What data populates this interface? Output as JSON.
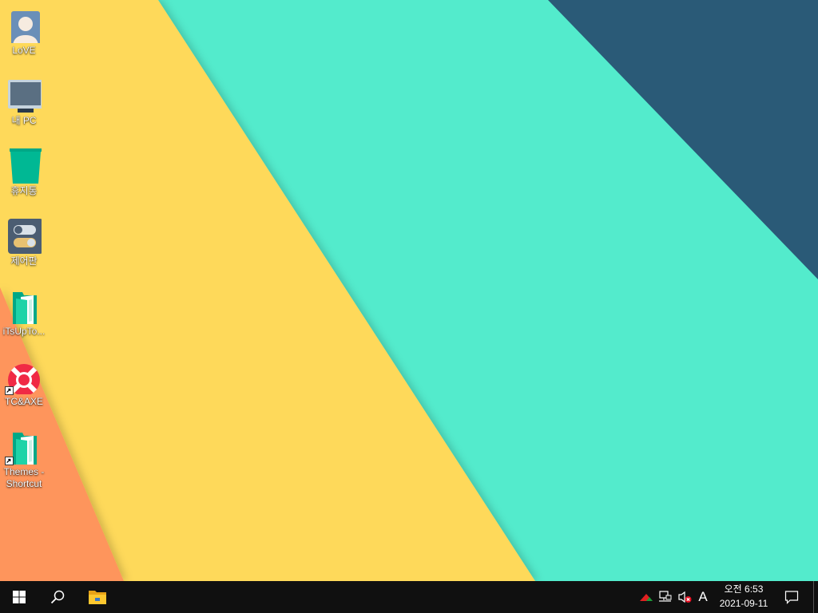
{
  "desktop": {
    "icons": [
      {
        "label": "LoVE",
        "icon": "user-icon"
      },
      {
        "label": "내 PC",
        "icon": "monitor-icon"
      },
      {
        "label": "휴지통",
        "icon": "recycle-bin-icon"
      },
      {
        "label": "제어판",
        "icon": "control-panel-icon"
      },
      {
        "label": "iTsUpTo...",
        "icon": "folder-icon"
      },
      {
        "label": "TC&AXE",
        "icon": "lifebuoy-icon"
      },
      {
        "label": "Themes - Shortcut",
        "icon": "folder-icon"
      }
    ]
  },
  "taskbar": {
    "start": "windows-logo-icon",
    "search": "search-icon",
    "explorer": "file-explorer-icon",
    "tray": {
      "input_indicator": "A",
      "clock_time": "오전 6:53",
      "clock_date": "2021-09-11"
    }
  },
  "colors": {
    "teal": "#53ebcc",
    "yellow": "#fed95a",
    "orange": "#fe955b",
    "navy": "#2a5a77",
    "taskbar": "#101010"
  }
}
